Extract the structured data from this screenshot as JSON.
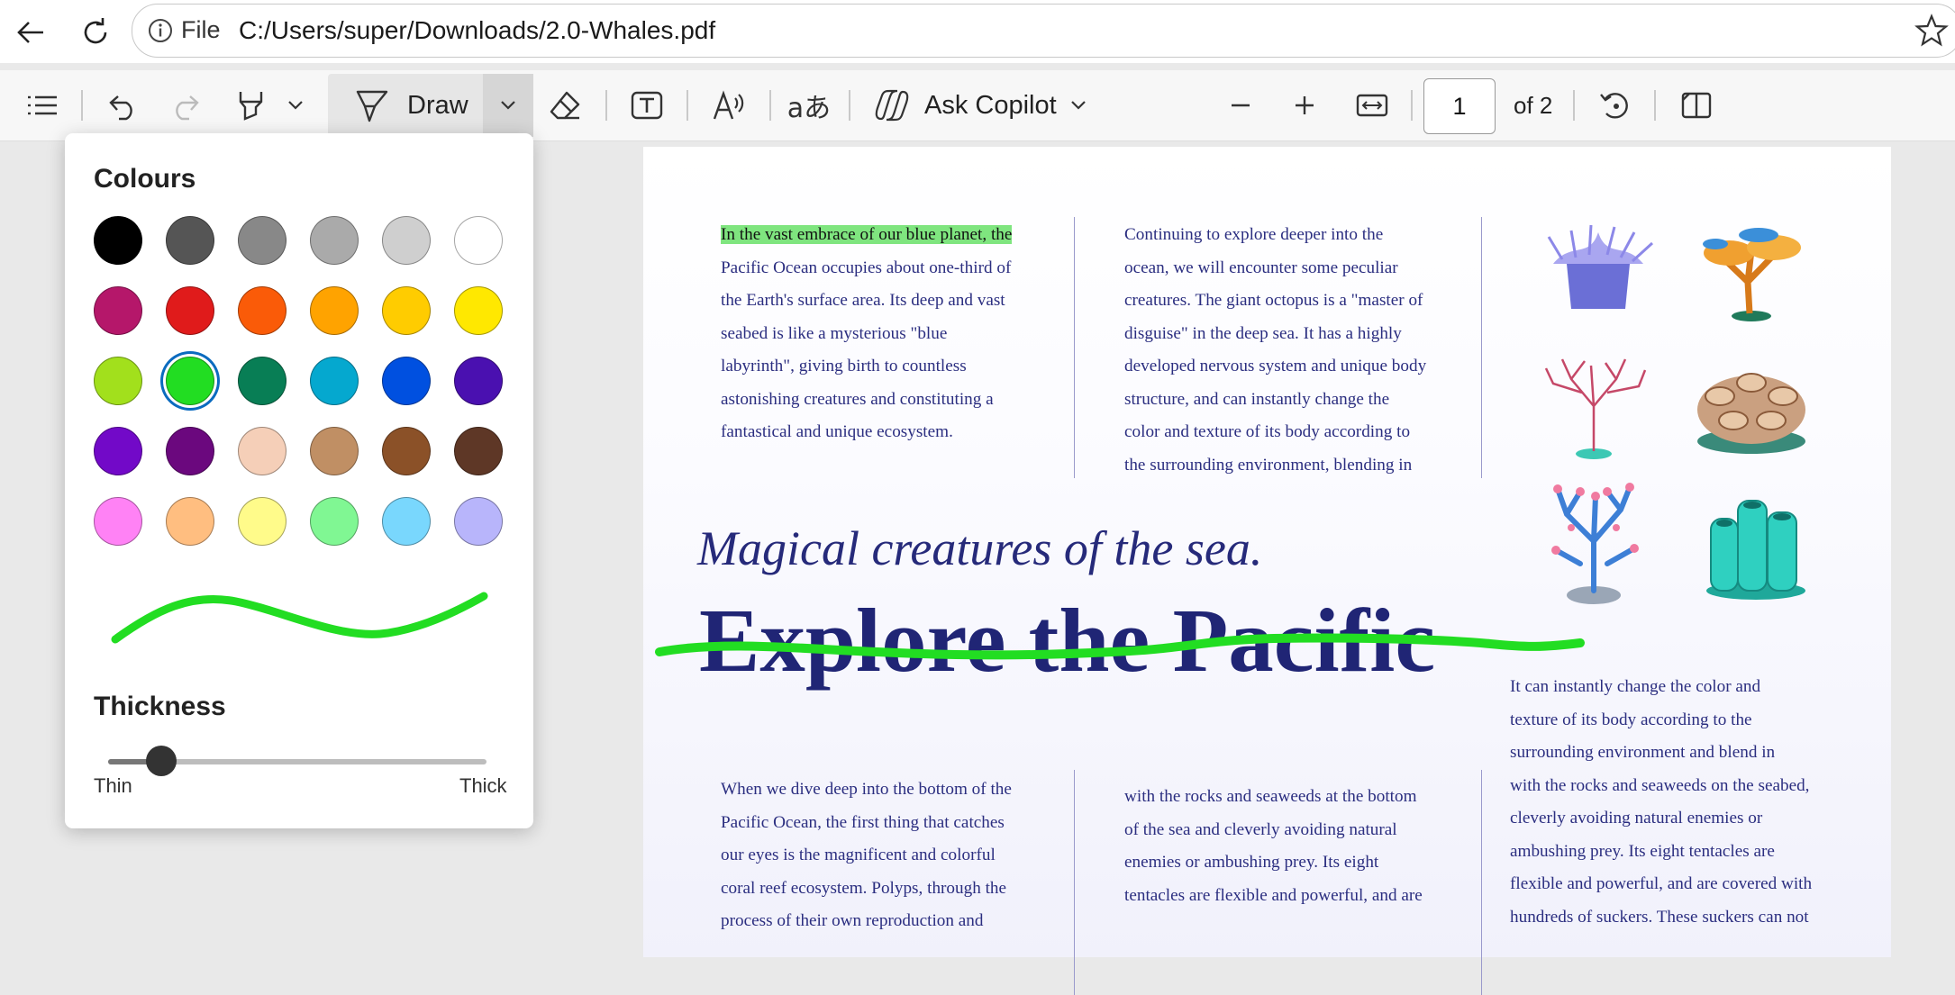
{
  "browser": {
    "file_label": "File",
    "url": "C:/Users/super/Downloads/2.0-Whales.pdf"
  },
  "toolbar": {
    "draw_label": "Draw",
    "copilot_label": "Ask Copilot",
    "page_number": "1",
    "page_total": "of 2"
  },
  "colour_panel": {
    "title": "Colours",
    "selected_colour": "#22dd22",
    "swatches": [
      "#000000",
      "#555555",
      "#888888",
      "#aaaaaa",
      "#cfcfcf",
      "#ffffff",
      "#b5176a",
      "#e01b1b",
      "#fa5b08",
      "#ffa300",
      "#ffcc00",
      "#ffe800",
      "#a2e01c",
      "#22dd22",
      "#087e55",
      "#05a8cf",
      "#0050e0",
      "#4a10b0",
      "#7209c8",
      "#6b087e",
      "#f5cfb8",
      "#c08f64",
      "#8b5128",
      "#5e3726",
      "#ff82f5",
      "#ffbe80",
      "#fffb8a",
      "#80f793",
      "#79d7fd",
      "#b8b5fb"
    ],
    "thickness_title": "Thickness",
    "thickness_value": 0.14,
    "thin_label": "Thin",
    "thick_label": "Thick"
  },
  "document": {
    "col1_highlight": "In the vast embrace of our blue planet, the",
    "col1_lines": [
      "Pacific Ocean occupies about one-third of",
      "the Earth's surface area. Its deep and vast",
      "seabed is like a mysterious \"blue",
      "labyrinth\", giving birth to countless",
      "astonishing creatures and constituting a",
      "fantastical and unique ecosystem."
    ],
    "col2_lines": [
      "Continuing to explore deeper into the",
      "ocean, we will encounter some peculiar",
      "creatures. The giant octopus is a \"master of",
      "disguise\" in the deep sea. It has a highly",
      "developed nervous system and unique body",
      "structure, and can instantly change the",
      "color and texture of its body according to",
      "the surrounding environment, blending in"
    ],
    "subtitle": "Magical creatures of the sea.",
    "title": "Explore the Pacific",
    "col3_lines": [
      "It can instantly change the color and",
      "texture of its body according to the",
      "surrounding environment and blend in",
      "with the rocks and seaweeds on the seabed,",
      "cleverly avoiding natural enemies or",
      "ambushing prey. Its eight tentacles are",
      "flexible and powerful, and are covered with",
      "hundreds of suckers. These suckers can not"
    ],
    "col4_lines": [
      "When we dive deep into the bottom of the",
      "Pacific Ocean, the first thing that catches",
      "our eyes is the magnificent and colorful",
      "coral reef ecosystem. Polyps, through the",
      "process of their own reproduction and"
    ],
    "col5_lines": [
      "with the rocks and seaweeds at the bottom",
      "of the sea and cleverly avoiding natural",
      "enemies or ambushing prey. Its eight",
      "tentacles are flexible and powerful, and are"
    ]
  }
}
